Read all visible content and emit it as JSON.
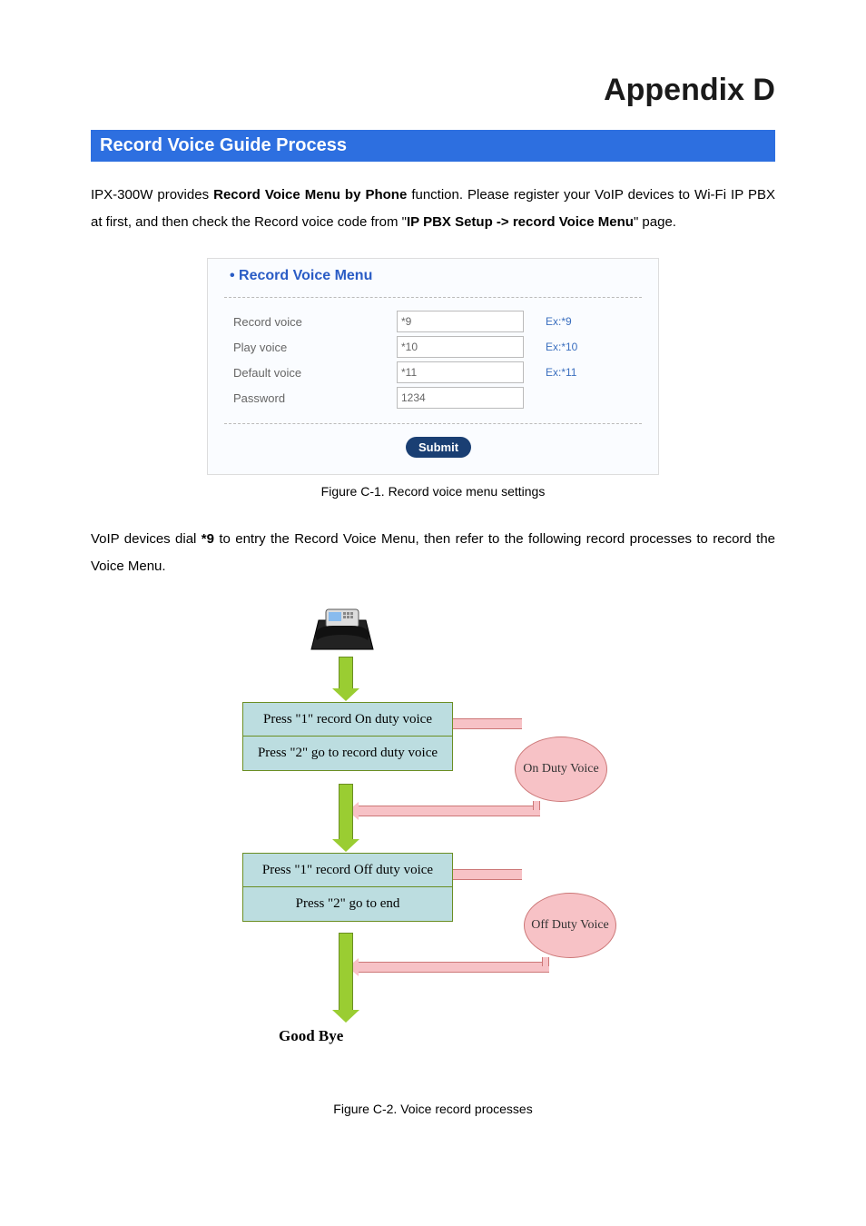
{
  "appendix_title": "Appendix D",
  "section_title": "Record Voice Guide Process",
  "intro": {
    "pre": "IPX-300W provides ",
    "bold1": "Record Voice Menu by Phone",
    "mid1": " function. Please register your VoIP devices to Wi-Fi IP PBX at first, and then check the Record voice code from \"",
    "bold2": "IP PBX Setup -> record Voice Menu",
    "post": "\" page."
  },
  "panel": {
    "title": "Record Voice Menu",
    "rows": [
      {
        "label": "Record voice",
        "value": "*9",
        "example": "Ex:*9"
      },
      {
        "label": "Play voice",
        "value": "*10",
        "example": "Ex:*10"
      },
      {
        "label": "Default voice",
        "value": "*11",
        "example": "Ex:*11"
      },
      {
        "label": "Password",
        "value": "1234",
        "example": ""
      }
    ],
    "submit_label": "Submit"
  },
  "caption1": "Figure C-1. Record voice menu settings",
  "para2": {
    "pre": "VoIP devices dial ",
    "bold": "*9",
    "post": " to entry the Record Voice Menu, then refer to the following record processes to record the Voice Menu."
  },
  "flow": {
    "pair1_a": "Press \"1\" record On duty voice",
    "pair1_b": "Press \"2\" go to record duty voice",
    "ellipse1": "On Duty Voice",
    "pair2_a": "Press \"1\" record Off duty voice",
    "pair2_b": "Press \"2\" go to end",
    "ellipse2": "Off Duty Voice",
    "goodbye": "Good Bye"
  },
  "caption2": "Figure C-2. Voice record processes"
}
